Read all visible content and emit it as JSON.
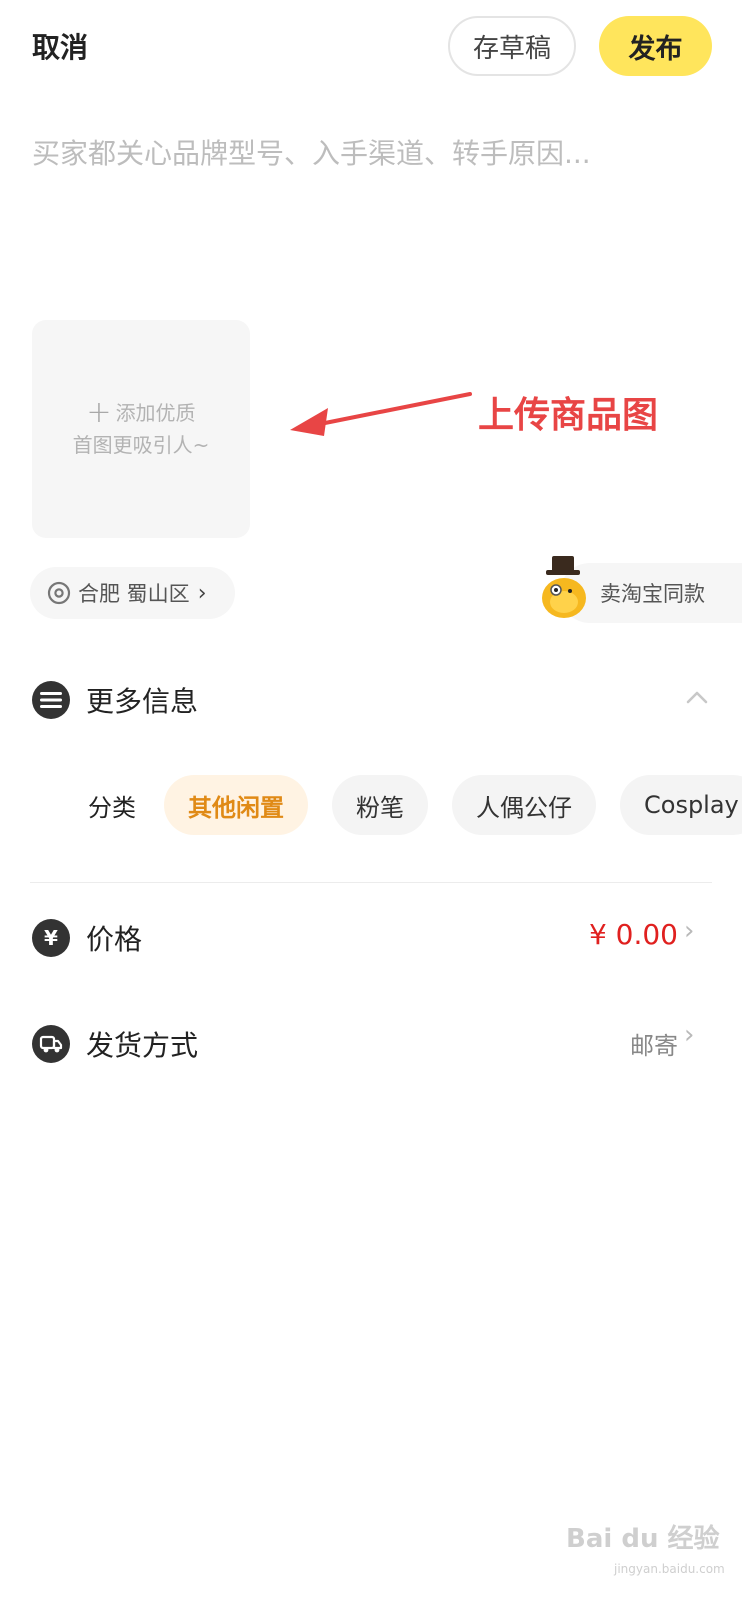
{
  "header": {
    "cancel_label": "取消",
    "draft_label": "存草稿",
    "publish_label": "发布"
  },
  "description": {
    "placeholder": "买家都关心品牌型号、入手渠道、转手原因...",
    "value": ""
  },
  "upload": {
    "line1": "添加优质",
    "line2": "首图更吸引人~"
  },
  "annotation": {
    "label": "上传商品图"
  },
  "location": {
    "text": "合肥 蜀山区"
  },
  "taobao": {
    "label": "卖淘宝同款"
  },
  "more_info": {
    "title": "更多信息",
    "category_label": "分类",
    "chips": [
      "其他闲置",
      "粉笔",
      "人偶公仔",
      "Cosplay"
    ]
  },
  "price": {
    "title": "价格",
    "value": "¥ 0.00"
  },
  "shipping": {
    "title": "发货方式",
    "value": "邮寄"
  },
  "watermark": {
    "main": "Bai du 经验",
    "url": "jingyan.baidu.com"
  },
  "colors": {
    "publish_bg": "#ffe55c",
    "price_red": "#e0201f",
    "chip_active_text": "#e08a16",
    "annotation_red": "#e84545"
  }
}
